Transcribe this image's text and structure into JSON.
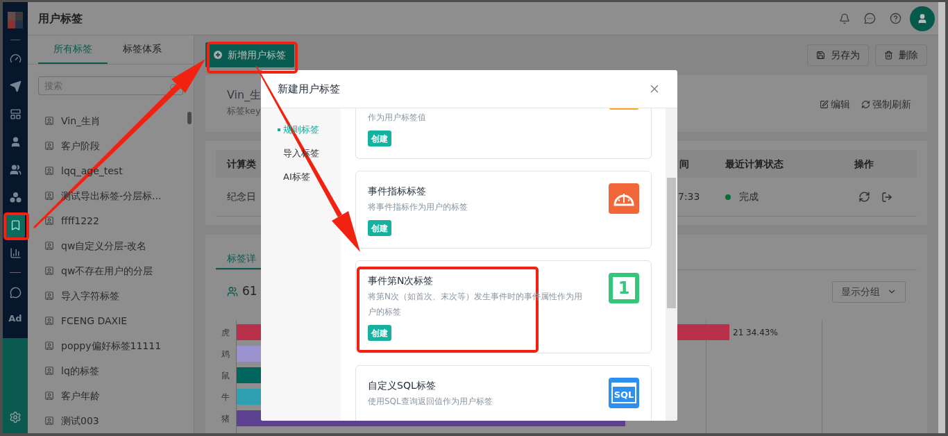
{
  "header": {
    "title": "用户标签"
  },
  "nav": {
    "items": [
      {
        "selected": false
      },
      {
        "selected": false
      },
      {
        "selected": false
      },
      {
        "selected": false
      },
      {
        "selected": false
      },
      {
        "selected": false
      },
      {
        "selected": true
      },
      {
        "selected": false
      },
      {
        "selected": false
      },
      {
        "label": "Ad",
        "selected": false
      }
    ]
  },
  "tag_panel": {
    "tabs": [
      {
        "label": "所有标签",
        "selected": true
      },
      {
        "label": "标签体系",
        "selected": false
      }
    ],
    "search": {
      "placeholder": "搜索"
    },
    "items": [
      "Vin_生肖",
      "客户阶段",
      "lqq_age_test",
      "测试导出标签-分层标...",
      "ffff1222",
      "qw自定义分层-改名",
      "qw不存在用户的分层",
      "导入字符标签",
      "FCENG DAXIE",
      "poppy偏好标签11111",
      "lq的标签",
      "客户年龄",
      "测试003"
    ]
  },
  "toolbar": {
    "add_button": "新增用户标签",
    "save_as_button": "另存为",
    "delete_button": "删除"
  },
  "tag_header": {
    "name": "Vin_生",
    "key_label": "标签key",
    "edit": "编辑",
    "refresh": "强制刷新"
  },
  "calc_table": {
    "columns": [
      "计算类",
      "间",
      "最近计算状态",
      "操作"
    ],
    "row": {
      "type": "纪念日",
      "time": "7:33",
      "status": "完成"
    }
  },
  "detail": {
    "tab": "标签详",
    "user_count": "61",
    "group_button": "显示分组",
    "bars": [
      {
        "label": "虎",
        "color": "#b8304a",
        "value_label": "21 34.43%"
      },
      {
        "label": "鸡",
        "color": "#9b93cf"
      },
      {
        "label": "鼠",
        "color": "#00655d"
      },
      {
        "label": "牛",
        "color": "#2f9fb2"
      },
      {
        "label": "猪",
        "color": "#5b418f"
      }
    ]
  },
  "modal": {
    "title": "新建用户标签",
    "menu": [
      {
        "label": "规则标签",
        "selected": true
      },
      {
        "label": "导入标签",
        "selected": false
      },
      {
        "label": "AI标签",
        "selected": false
      }
    ],
    "cards": [
      {
        "kind": "partial",
        "description": "作为用户标签值",
        "create": "创建",
        "color": "#f5a623"
      },
      {
        "kind": "gauge",
        "title": "事件指标标签",
        "description": "将事件指标作为用户的标签",
        "create": "创建",
        "color": "#f2673a"
      },
      {
        "kind": "number",
        "title": "事件第N次标签",
        "description": "将第N次（如首次、末次等）发生事件时的事件属性作为用户的标签",
        "create": "创建",
        "color": "#34c77b",
        "icon_text": "1"
      },
      {
        "kind": "sql",
        "title": "自定义SQL标签",
        "description": "使用SQL查询返回值作为用户标签",
        "color": "#2e8ff0",
        "icon_text": "SQL"
      }
    ]
  }
}
